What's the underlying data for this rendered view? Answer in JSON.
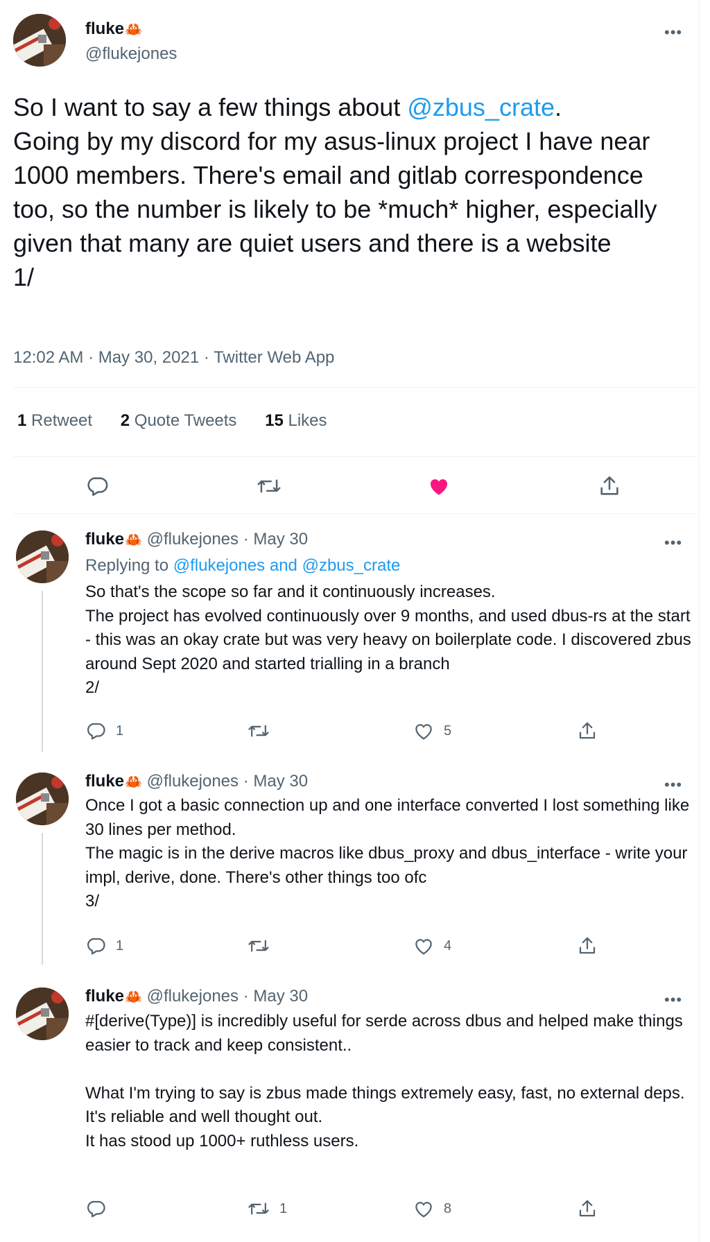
{
  "main_tweet": {
    "display_name": "fluke",
    "name_emoji": "🦀",
    "handle": "@flukejones",
    "text_before_mention": "So I want to say a few things about ",
    "mention": "@zbus_crate",
    "text_after_mention": ".\nGoing by my discord for my asus-linux project I have near 1000 members. There's email and gitlab correspondence too, so the number is likely to be *much* higher, especially given that many are quiet users and there is a website\n1/",
    "time": "12:02 AM",
    "date": "May 30, 2021",
    "source": "Twitter Web App",
    "separator": "·",
    "stats": {
      "retweets_count": "1",
      "retweets_label": "Retweet",
      "quotes_count": "2",
      "quotes_label": "Quote Tweets",
      "likes_count": "15",
      "likes_label": "Likes"
    },
    "liked": true,
    "like_color": "#f91880"
  },
  "replies": [
    {
      "display_name": "fluke",
      "name_emoji": "🦀",
      "handle": "@flukejones",
      "date": "May 30",
      "replying_prefix": "Replying to ",
      "replying_user1": "@flukejones",
      "replying_and": " and ",
      "replying_user2": "@zbus_crate",
      "text": "So that's the scope so far and it continuously increases.\nThe project has evolved continuously over 9 months, and used dbus-rs at the start - this was an okay crate but was very heavy on boilerplate code. I discovered zbus around Sept 2020 and started trialling in a branch\n2/",
      "reply_count": "1",
      "retweet_count": "",
      "like_count": "5"
    },
    {
      "display_name": "fluke",
      "name_emoji": "🦀",
      "handle": "@flukejones",
      "date": "May 30",
      "text": "Once I got a basic connection up and one interface converted I lost something like 30 lines per method.\nThe magic is in the derive macros like dbus_proxy and dbus_interface - write your impl, derive, done. There's other things too ofc\n3/",
      "reply_count": "1",
      "retweet_count": "",
      "like_count": "4"
    },
    {
      "display_name": "fluke",
      "name_emoji": "🦀",
      "handle": "@flukejones",
      "date": "May 30",
      "text": "#[derive(Type)] is incredibly useful for serde across dbus and helped make things easier to track and keep consistent..\n\nWhat I'm trying to say is zbus made things extremely easy, fast, no external deps.\nIt's reliable and well thought out.\nIt has stood up 1000+ ruthless users.",
      "reply_count": "",
      "retweet_count": "1",
      "like_count": "8"
    }
  ],
  "icons": {
    "more": "more-dots-icon",
    "reply": "reply-icon",
    "retweet": "retweet-icon",
    "like": "heart-icon",
    "share": "share-icon"
  },
  "more_glyph": "•••",
  "colors": {
    "link": "#1d9bf0",
    "muted": "#536471",
    "text": "#0f1419"
  }
}
